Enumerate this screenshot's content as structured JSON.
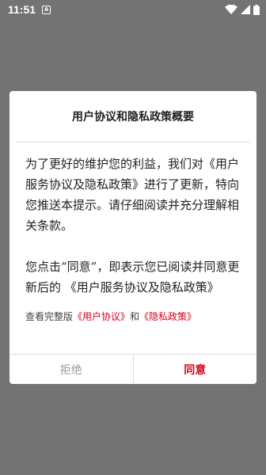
{
  "status_bar": {
    "time": "11:51",
    "notification_icon": "A",
    "icons": [
      "wifi-icon",
      "signal-icon",
      "battery-icon"
    ]
  },
  "dialog": {
    "title": "用户协议和隐私政策概要",
    "paragraph1": "为了更好的维护您的利益，我们对《用户服务协议及隐私政策》进行了更新，特向您推送本提示。请仔细阅读并充分理解相关条款。",
    "paragraph2": "您点击“同意”，即表示您已阅读并同意更新后的 《用户服务协议及隐私政策》",
    "view_prefix": "查看完整版",
    "user_agreement_link": "《用户协议》",
    "view_and": "和",
    "privacy_policy_link": "《隐私政策》",
    "reject_label": "拒绝",
    "agree_label": "同意"
  },
  "colors": {
    "overlay": "#737373",
    "accent": "#d0021b",
    "muted": "#9a9a9a"
  }
}
